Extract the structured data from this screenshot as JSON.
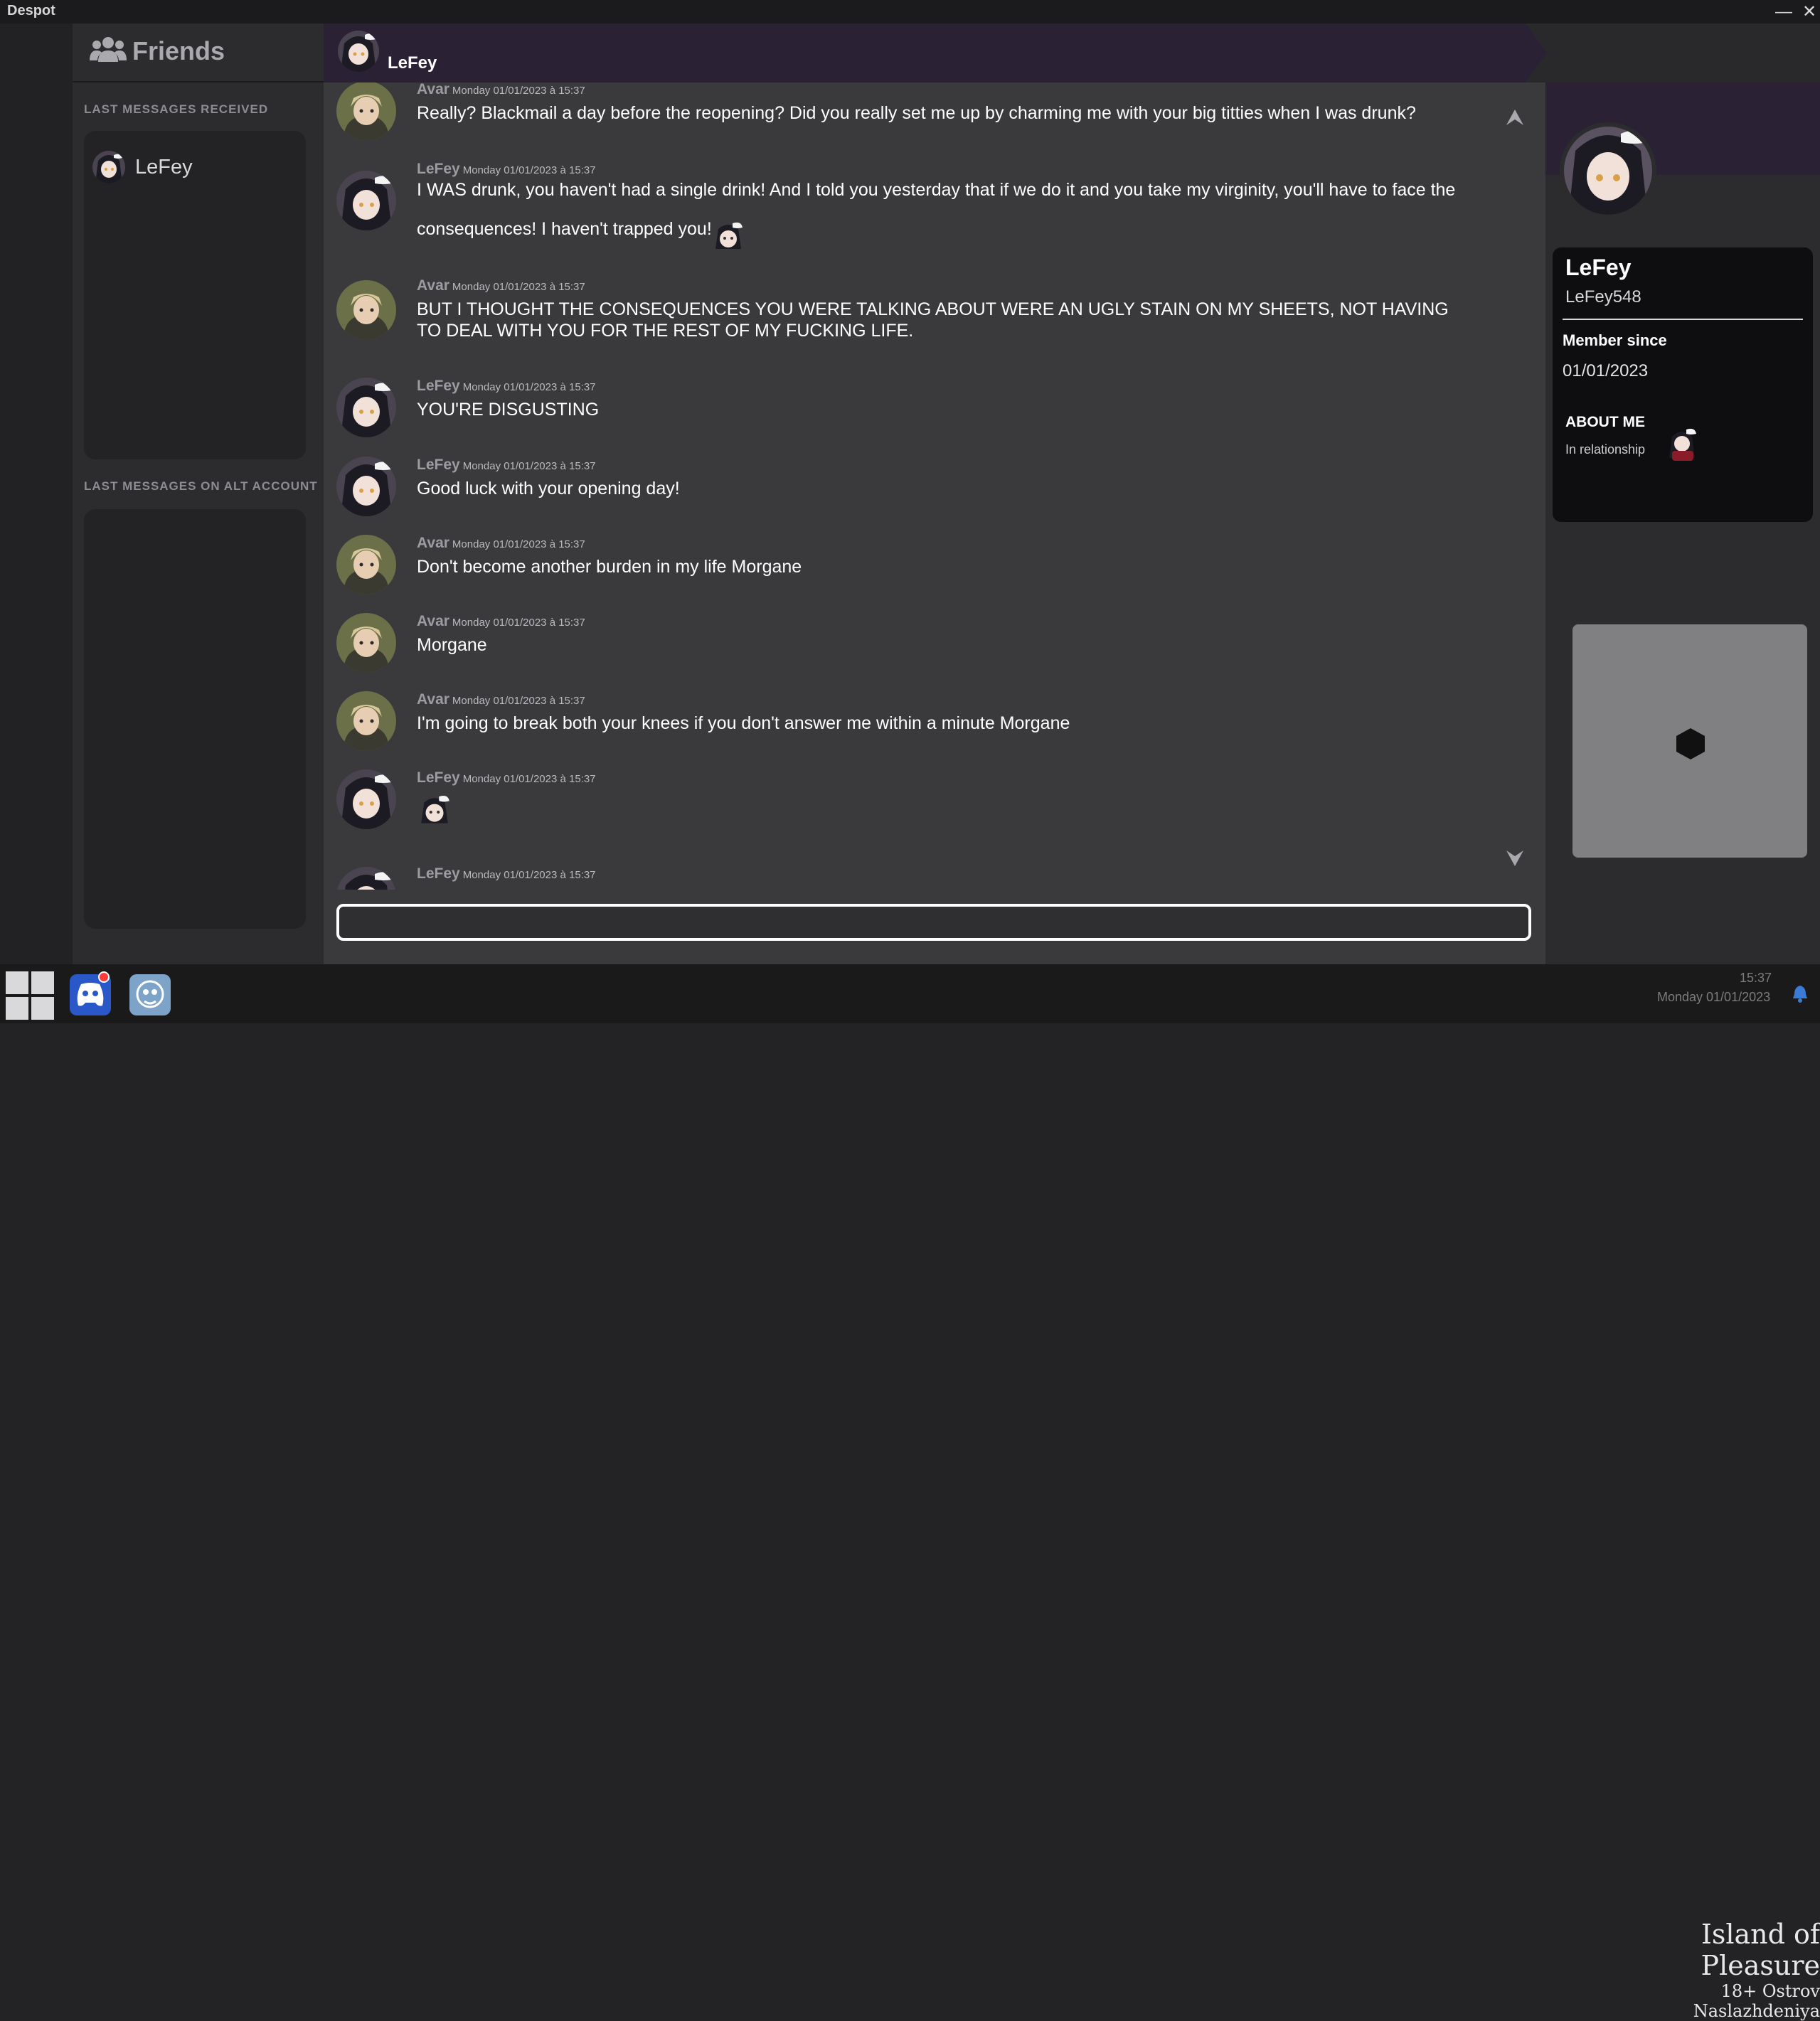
{
  "app": {
    "title": "Despot"
  },
  "window_controls": {
    "minimize": "—",
    "close": "✕"
  },
  "sidebar": {
    "header": {
      "icon": "friends-icon",
      "title": "Friends"
    },
    "received_heading": "LAST MESSAGES RECEIVED",
    "received_items": [
      {
        "name": "LeFey",
        "icon": "avatar"
      }
    ],
    "alt_heading": "LAST MESSAGES ON ALT ACCOUNT"
  },
  "chat": {
    "header_name": "LeFey",
    "messages": [
      {
        "author": "Avar",
        "time": "Monday 01/01/2023 à 15:37",
        "text": "Really? Blackmail a day before the reopening? Did you really set me up by charming me with your big titties when I was drunk?"
      },
      {
        "author": "LeFey",
        "time": "Monday 01/01/2023 à 15:37",
        "text": "I WAS drunk, you haven't had a single drink! And I told you yesterday that if we do it and you take my virginity, you'll have to face the consequences! I haven't trapped you!"
      },
      {
        "author": "Avar",
        "time": "Monday 01/01/2023 à 15:37",
        "text": "BUT I THOUGHT THE CONSEQUENCES YOU WERE TALKING ABOUT WERE AN UGLY STAIN ON MY SHEETS, NOT HAVING TO DEAL WITH YOU FOR THE REST OF MY FUCKING LIFE."
      },
      {
        "author": "LeFey",
        "time": "Monday 01/01/2023 à 15:37",
        "text": "YOU'RE DISGUSTING"
      },
      {
        "author": "LeFey",
        "time": "Monday 01/01/2023 à 15:37",
        "text": "Good luck with your opening day!"
      },
      {
        "author": "Avar",
        "time": "Monday 01/01/2023 à 15:37",
        "text": "Don't become another burden in my life Morgane"
      },
      {
        "author": "Avar",
        "time": "Monday 01/01/2023 à 15:37",
        "text": "Morgane"
      },
      {
        "author": "Avar",
        "time": "Monday 01/01/2023 à 15:37",
        "text": "I'm going to break both your knees if you don't answer me within a minute Morgane"
      },
      {
        "author": "LeFey",
        "time": "Monday 01/01/2023 à 15:37",
        "text": ""
      },
      {
        "author": "LeFey",
        "time": "Monday 01/01/2023 à 15:37",
        "text": ""
      }
    ],
    "input": {
      "value": "",
      "placeholder": ""
    }
  },
  "profile": {
    "name": "LeFey",
    "handle": "LeFey548",
    "member_since_label": "Member since",
    "member_since": "01/01/2023",
    "about_label": "ABOUT ME",
    "about_text": "In relationship"
  },
  "taskbar": {
    "apps": [
      "start-menu",
      "discord-app",
      "chat-app"
    ],
    "notification_badge": true
  },
  "watermark": {
    "title": "Island of Pleasure",
    "subtitle": "18+ Ostrov Naslazhdeniya"
  },
  "tray": {
    "clock": "15:37",
    "date": "Monday 01/01/2023"
  },
  "colors": {
    "header_banner": "#2a2135",
    "panel": "#2c2c2f",
    "chat_bg": "#3a3a3d",
    "profile_card": "#0e0e10"
  }
}
